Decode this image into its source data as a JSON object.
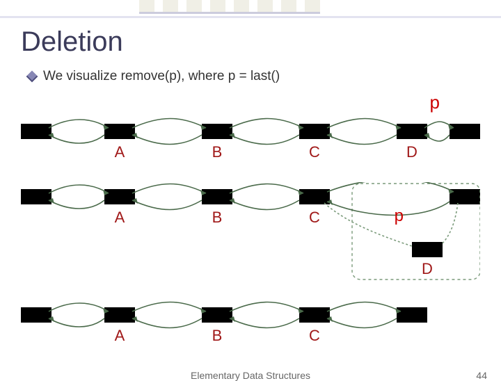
{
  "title": "Deletion",
  "bullet": "We visualize remove(p), where p = last()",
  "pointer_label": "p",
  "rows": [
    {
      "nodes": [
        "",
        "A",
        "B",
        "C",
        "D",
        ""
      ],
      "pointer_at": 4
    },
    {
      "nodes": [
        "",
        "A",
        "B",
        "C",
        ""
      ],
      "detached": "D",
      "pointer_at": "detached"
    },
    {
      "nodes": [
        "",
        "A",
        "B",
        "C",
        ""
      ]
    }
  ],
  "footer": {
    "mid": "Elementary Data Structures",
    "page": "44"
  }
}
